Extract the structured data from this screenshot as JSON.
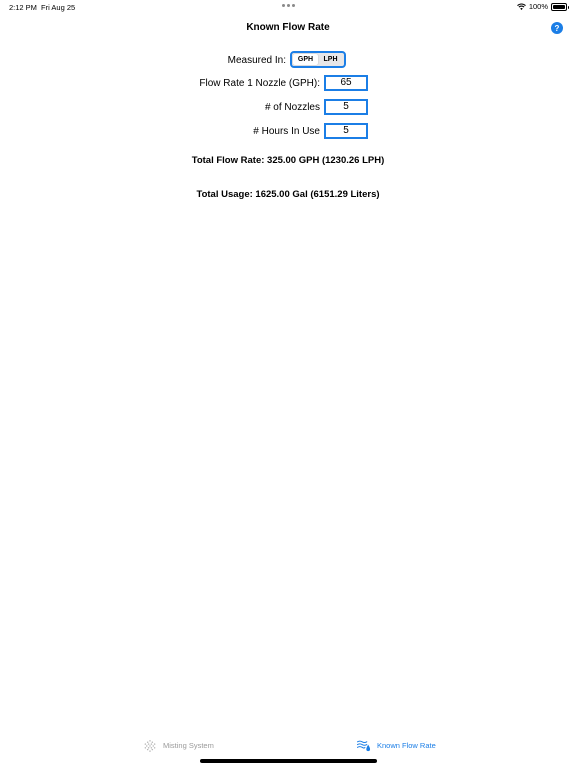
{
  "status_bar": {
    "time": "2:12 PM",
    "date": "Fri Aug 25",
    "battery": "100%"
  },
  "nav": {
    "title": "Known Flow Rate",
    "help_label": "?"
  },
  "form": {
    "measured_in_label": "Measured In:",
    "unit_options": [
      "GPH",
      "LPH"
    ],
    "selected_unit": "GPH",
    "flow_rate_label": "Flow Rate 1 Nozzle (GPH):",
    "flow_rate_value": "65",
    "nozzles_label": "# of Nozzles",
    "nozzles_value": "5",
    "hours_label": "# Hours In Use",
    "hours_value": "5"
  },
  "results": {
    "total_flow_rate": "Total Flow Rate: 325.00 GPH (1230.26 LPH)",
    "total_usage": "Total Usage: 1625.00 Gal (6151.29 Liters)"
  },
  "tab_bar": {
    "tabs": [
      {
        "label": "Misting System",
        "icon": "misting-icon",
        "active": false
      },
      {
        "label": "Known Flow Rate",
        "icon": "flow-rate-icon",
        "active": true
      }
    ]
  },
  "colors": {
    "accent": "#1b7ee6",
    "inactive": "#9a9a9a"
  }
}
